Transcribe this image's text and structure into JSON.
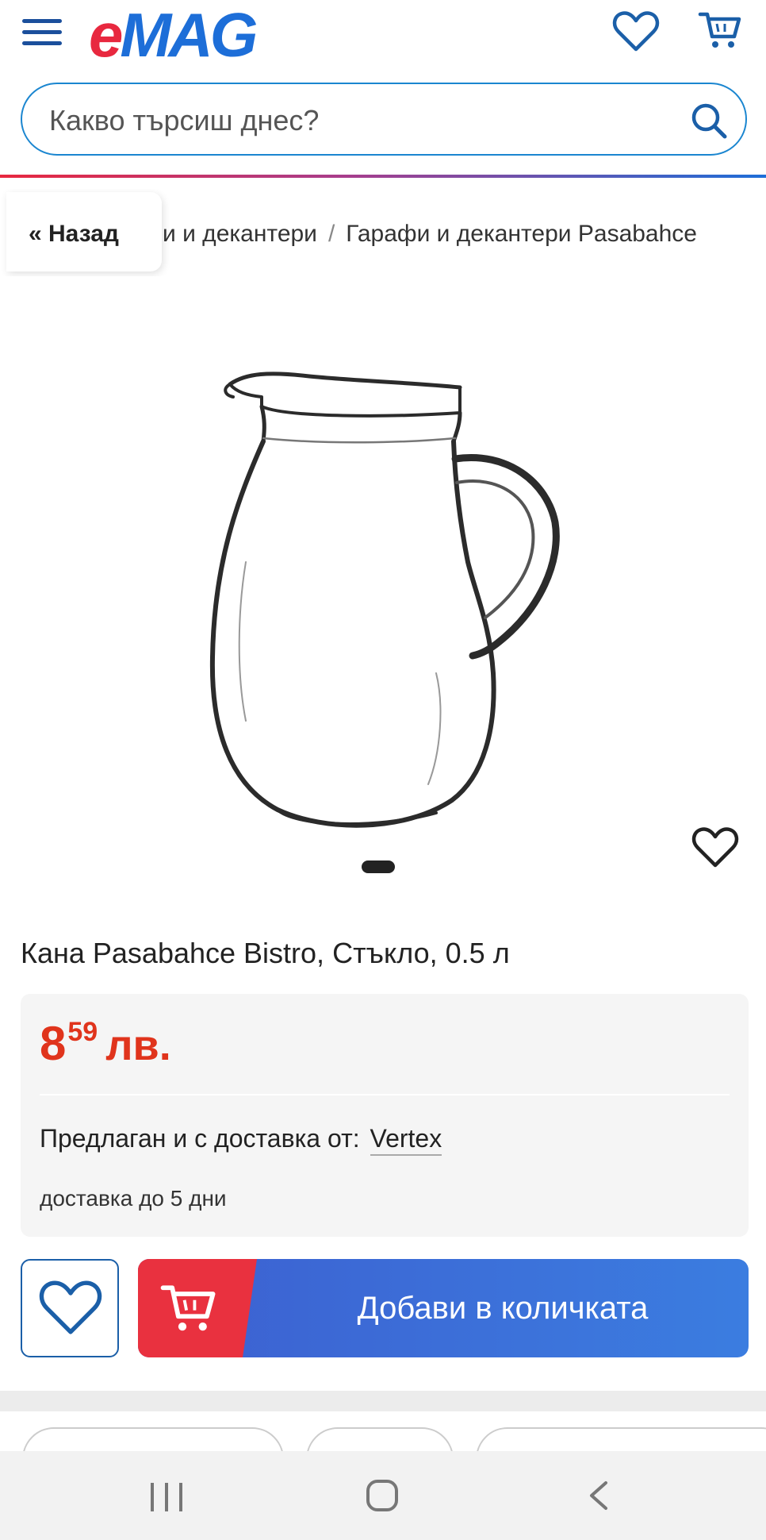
{
  "header": {
    "logo_e": "e",
    "logo_mag": "MAG",
    "menu_icon": "hamburger-icon",
    "favorites_icon": "heart-icon",
    "cart_icon": "cart-icon"
  },
  "search": {
    "placeholder": "Какво търсиш днес?",
    "icon": "search-icon"
  },
  "breadcrumb": {
    "back_label": "« Назад",
    "items": [
      "и и декантери",
      "Гарафи и декантери Pasabahce"
    ],
    "separator": "/"
  },
  "gallery": {
    "image": "glass pitcher",
    "active_index": 0,
    "favorite_icon": "heart-icon"
  },
  "product": {
    "title": "Кана Pasabahce Bistro, Стъкло, 0.5 л",
    "price_int": "8",
    "price_dec": "59",
    "currency": "лв.",
    "seller_label": "Предлаган и с доставка от:",
    "seller_name": "Vertex",
    "delivery": "доставка до 5 дни"
  },
  "actions": {
    "add_to_cart_label": "Добави в количката",
    "favorite_icon": "heart-icon",
    "cart_icon": "cart-icon"
  },
  "system_nav": {
    "recent_icon": "recent-apps-icon",
    "home_icon": "home-icon",
    "back_icon": "back-icon"
  },
  "colors": {
    "brand_red": "#e8283f",
    "brand_blue": "#1d6ed8",
    "price": "#e0341c",
    "cart_button": "#3b7de0"
  }
}
